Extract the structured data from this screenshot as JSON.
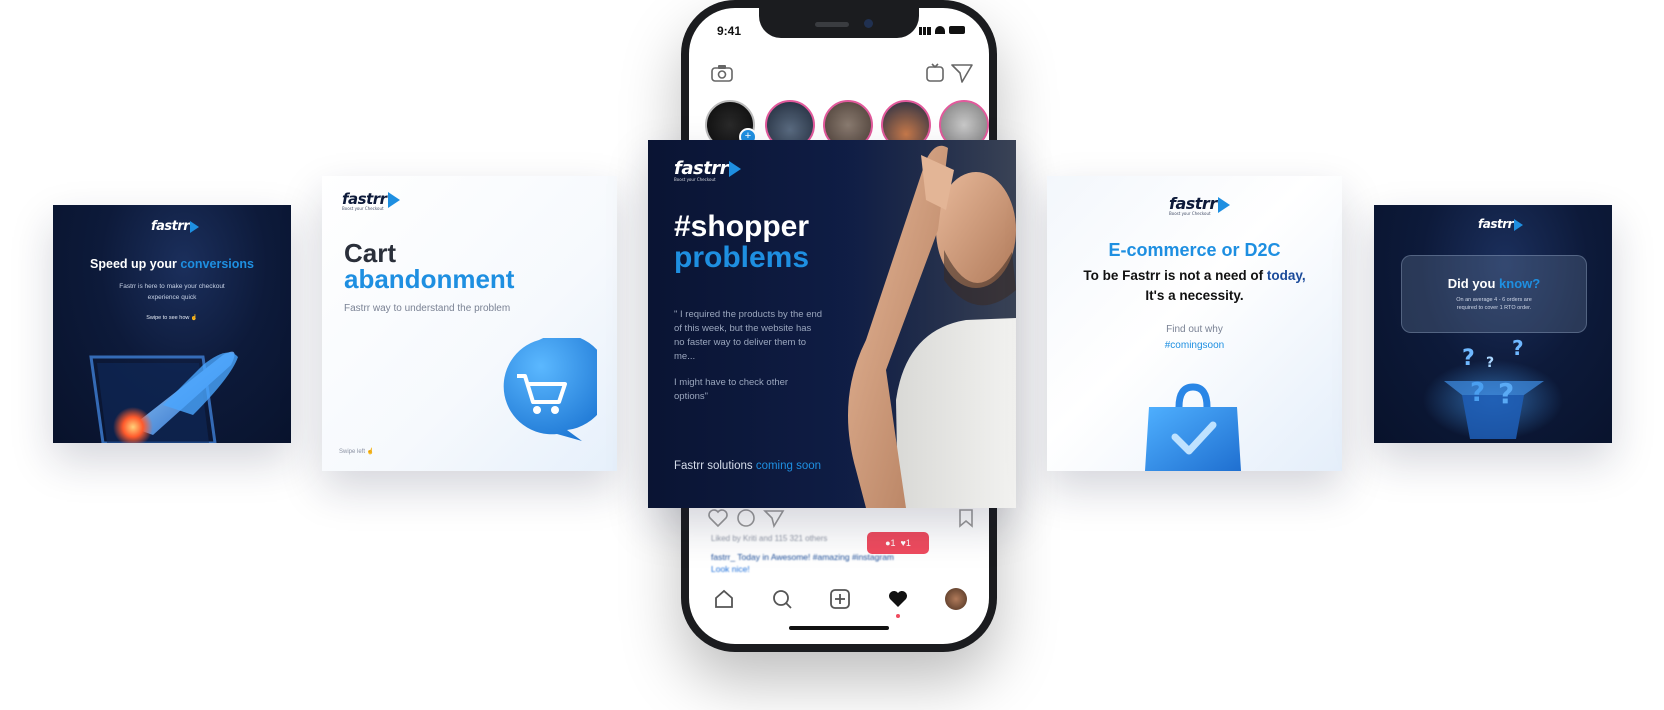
{
  "brand": {
    "name": "fastrr",
    "tagline": "Boost your Checkout"
  },
  "phone": {
    "time": "9:41",
    "likes_text": "Liked by Kriti and 115 321 others",
    "caption": "fastrr_ Today in Awesome! #amazing #instagram",
    "caption2": "Look nice!",
    "notif_comments": "1",
    "notif_likes": "1"
  },
  "card1": {
    "title_plain": "Speed up your ",
    "title_accent": "conversions",
    "body": "Fastrr is here to make your checkout experience quick",
    "cta": "Swipe to see how"
  },
  "card2": {
    "title_line1": "Cart",
    "title_line2": "abandonment",
    "subtitle": "Fastrr way to understand the problem",
    "footer": "Swipe left"
  },
  "card3": {
    "title_line1": "#shopper",
    "title_line2": "problems",
    "quote": "\" I required the products by the end of this week, but the website has no faster way to deliver them to me...",
    "quote2": "I might have to check other options\"",
    "footer_plain": "Fastrr solutions ",
    "footer_accent": "coming soon"
  },
  "card4": {
    "title": "E-commerce or D2C",
    "line1_plain": "To be Fastrr is not a need of ",
    "line1_accent": "today,",
    "line2": "It's a necessity.",
    "find": "Find out why",
    "hashtag": "#comingsoon"
  },
  "card5": {
    "title_plain": "Did you ",
    "title_accent": "know?",
    "body": "On an average 4 - 6 orders are required to cover 1 RTO order."
  },
  "colors": {
    "accent": "#1e8fe1",
    "dark_bg": "#0d1a3a",
    "story_ring": "#e25a9c",
    "notif": "#ef4b5e"
  }
}
